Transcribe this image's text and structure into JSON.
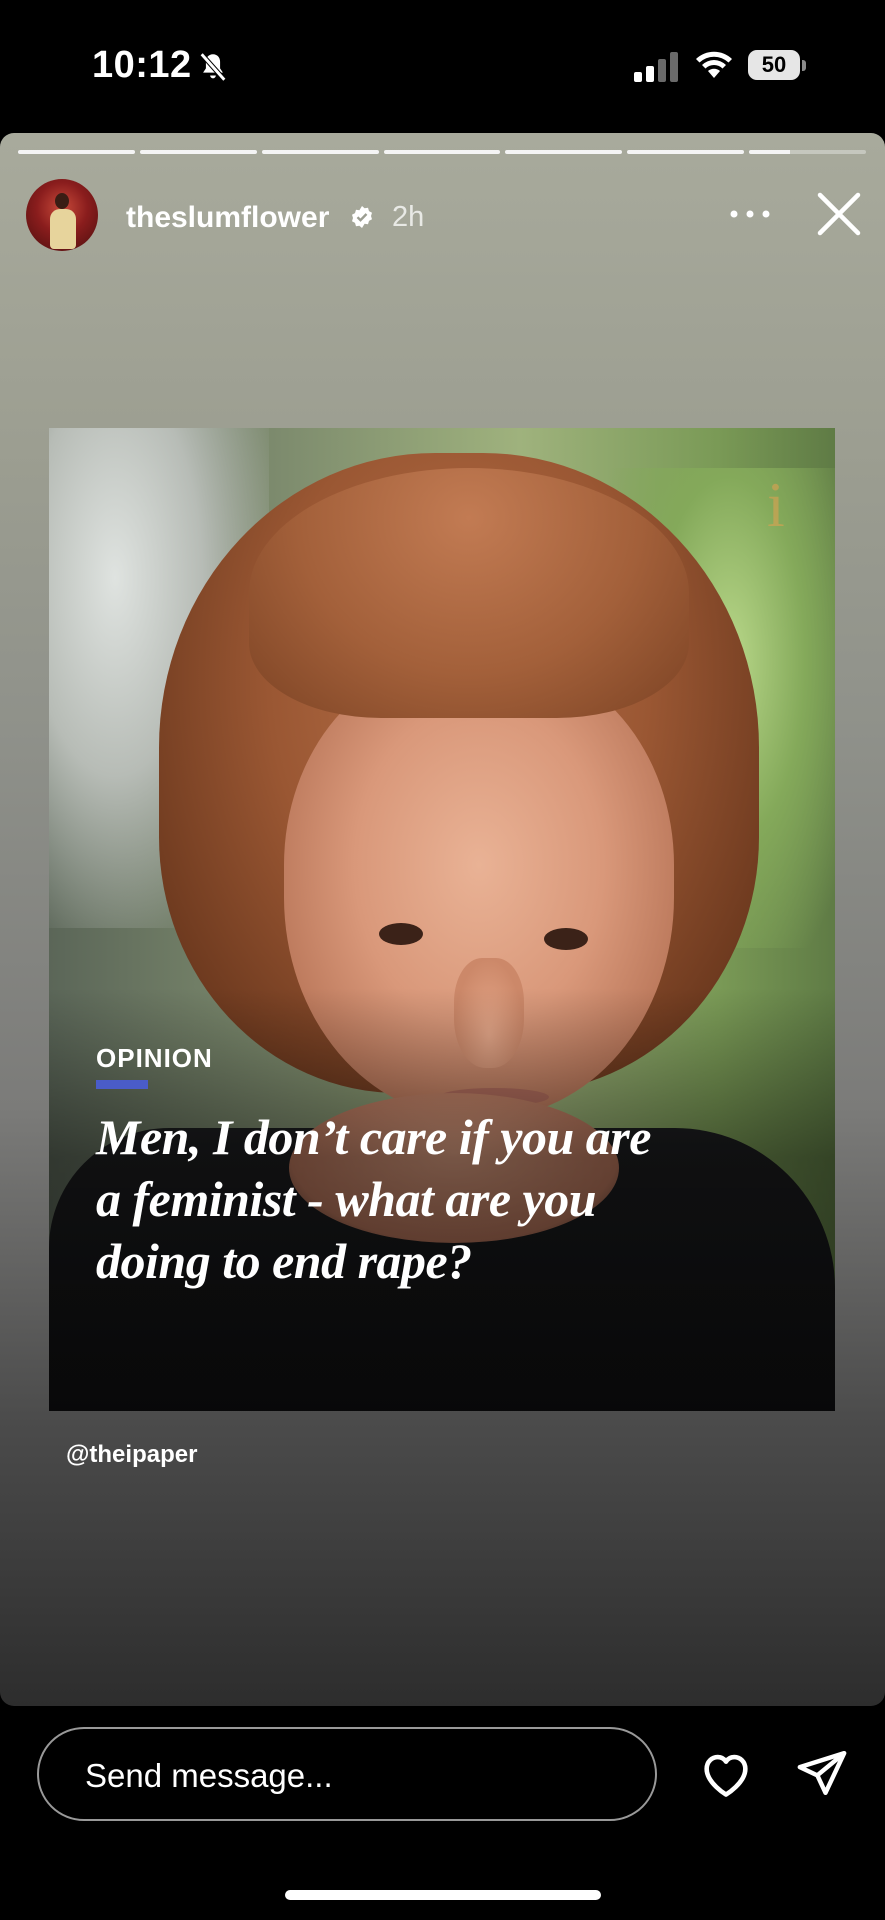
{
  "status_bar": {
    "time": "10:12",
    "battery": "50",
    "icons": [
      "bell-muted-icon",
      "cellular-signal-icon",
      "wifi-icon",
      "battery-icon"
    ]
  },
  "story": {
    "progress": {
      "segments": 7,
      "current_segment_fill": 0.35
    },
    "username": "theslumflower",
    "verified_icon": "verified-badge-icon",
    "time_ago": "2h",
    "more_icon": "more-icon",
    "close_icon": "close-icon",
    "post": {
      "publication_logo": "i",
      "section": "OPINION",
      "headline": "Men, I don’t care if you are a feminist - what are you doing to end rape?",
      "accent_color": "#4a5cc8"
    },
    "mention": "@theipaper"
  },
  "reply_bar": {
    "placeholder": "Send message...",
    "like_icon": "heart-icon",
    "share_icon": "send-icon"
  }
}
